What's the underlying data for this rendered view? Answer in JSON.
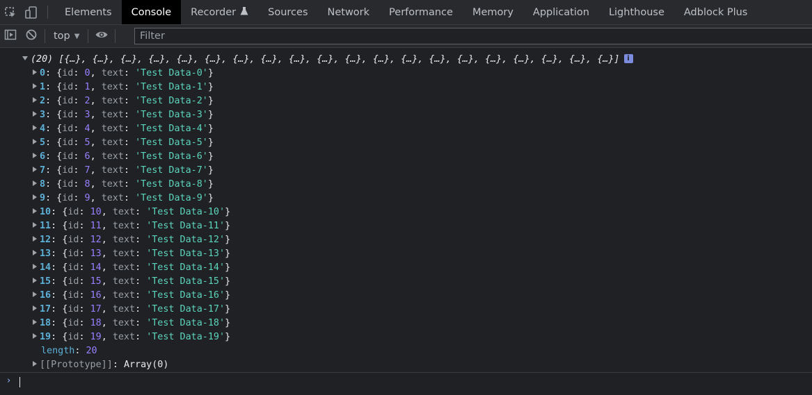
{
  "tabs": {
    "inspect_icon": "inspect-element-icon",
    "device_icon": "device-toolbar-icon",
    "items": [
      {
        "label": "Elements"
      },
      {
        "label": "Console"
      },
      {
        "label": "Recorder"
      },
      {
        "label": "Sources"
      },
      {
        "label": "Network"
      },
      {
        "label": "Performance"
      },
      {
        "label": "Memory"
      },
      {
        "label": "Application"
      },
      {
        "label": "Lighthouse"
      },
      {
        "label": "Adblock Plus"
      }
    ],
    "active": "Console"
  },
  "toolbar": {
    "context": "top",
    "filter_placeholder": "Filter"
  },
  "console": {
    "array_summary": "(20) [{…}, {…}, {…}, {…}, {…}, {…}, {…}, {…}, {…}, {…}, {…}, {…}, {…}, {…}, {…}, {…}, {…}, {…}, {…}, {…}]",
    "info_badge": "i",
    "entries": [
      {
        "key": "0",
        "id": "0",
        "text": "'Test Data-0'"
      },
      {
        "key": "1",
        "id": "1",
        "text": "'Test Data-1'"
      },
      {
        "key": "2",
        "id": "2",
        "text": "'Test Data-2'"
      },
      {
        "key": "3",
        "id": "3",
        "text": "'Test Data-3'"
      },
      {
        "key": "4",
        "id": "4",
        "text": "'Test Data-4'"
      },
      {
        "key": "5",
        "id": "5",
        "text": "'Test Data-5'"
      },
      {
        "key": "6",
        "id": "6",
        "text": "'Test Data-6'"
      },
      {
        "key": "7",
        "id": "7",
        "text": "'Test Data-7'"
      },
      {
        "key": "8",
        "id": "8",
        "text": "'Test Data-8'"
      },
      {
        "key": "9",
        "id": "9",
        "text": "'Test Data-9'"
      },
      {
        "key": "10",
        "id": "10",
        "text": "'Test Data-10'"
      },
      {
        "key": "11",
        "id": "11",
        "text": "'Test Data-11'"
      },
      {
        "key": "12",
        "id": "12",
        "text": "'Test Data-12'"
      },
      {
        "key": "13",
        "id": "13",
        "text": "'Test Data-13'"
      },
      {
        "key": "14",
        "id": "14",
        "text": "'Test Data-14'"
      },
      {
        "key": "15",
        "id": "15",
        "text": "'Test Data-15'"
      },
      {
        "key": "16",
        "id": "16",
        "text": "'Test Data-16'"
      },
      {
        "key": "17",
        "id": "17",
        "text": "'Test Data-17'"
      },
      {
        "key": "18",
        "id": "18",
        "text": "'Test Data-18'"
      },
      {
        "key": "19",
        "id": "19",
        "text": "'Test Data-19'"
      }
    ],
    "length_label": "length",
    "length_value": "20",
    "prototype_label": "[[Prototype]]",
    "prototype_value": "Array(0)"
  },
  "colors": {
    "background": "#202124",
    "key": "#5db0d7",
    "number": "#9980ff",
    "string": "#5cd5bd"
  }
}
